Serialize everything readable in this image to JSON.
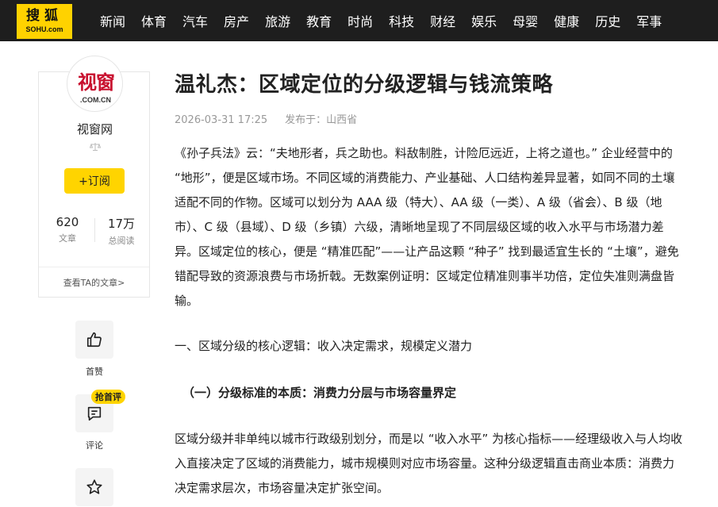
{
  "nav": {
    "logo_cn": "搜狐",
    "logo_en": "SOHU.com",
    "items": [
      "新闻",
      "体育",
      "汽车",
      "房产",
      "旅游",
      "教育",
      "时尚",
      "科技",
      "财经",
      "娱乐",
      "母婴",
      "健康",
      "历史",
      "军事"
    ]
  },
  "author": {
    "avatar_text": "视窗",
    "avatar_sub": ".COM.CN",
    "name": "视窗网",
    "subscribe_label": "+订阅",
    "articles_count": "620",
    "articles_label": "文章",
    "reads_count": "17万",
    "reads_label": "总阅读",
    "more_link": "查看TA的文章>"
  },
  "actions": {
    "like_label": "首赞",
    "comment_label": "评论",
    "comment_badge": "抢首评"
  },
  "article": {
    "title": "温礼杰：区域定位的分级逻辑与钱流策略",
    "date": "2026-03-31 17:25",
    "published_from": "发布于：山西省",
    "p1": "《孙子兵法》云：“夫地形者，兵之助也。料敌制胜，计险厄远近，上将之道也。” 企业经营中的 “地形”，便是区域市场。不同区域的消费能力、产业基础、人口结构差异显著，如同不同的土壤适配不同的作物。区域可以划分为 AAA 级（特大）、AA 级（一类）、A 级（省会）、B 级（地市）、C 级（县域）、D 级（乡镇）六级，清晰地呈现了不同层级区域的收入水平与市场潜力差异。区域定位的核心，便是 “精准匹配”——让产品这颗 “种子” 找到最适宜生长的 “土壤”，避免错配导致的资源浪费与市场折戟。无数案例证明：区域定位精准则事半功倍，定位失准则满盘皆输。",
    "p2": "一、区域分级的核心逻辑：收入决定需求，规模定义潜力",
    "p3": "（一）分级标准的本质：消费力分层与市场容量界定",
    "p4": "区域分级并非单纯以城市行政级别划分，而是以 “收入水平” 为核心指标——经理级收入与人均收入直接决定了区域的消费能力，城市规模则对应市场容量。这种分级逻辑直击商业本质：消费力决定需求层次，市场容量决定扩张空间。"
  },
  "colors": {
    "nav_bg": "#1e1e1e",
    "accent_yellow": "#ffd400",
    "logo_red": "#c8102e"
  }
}
